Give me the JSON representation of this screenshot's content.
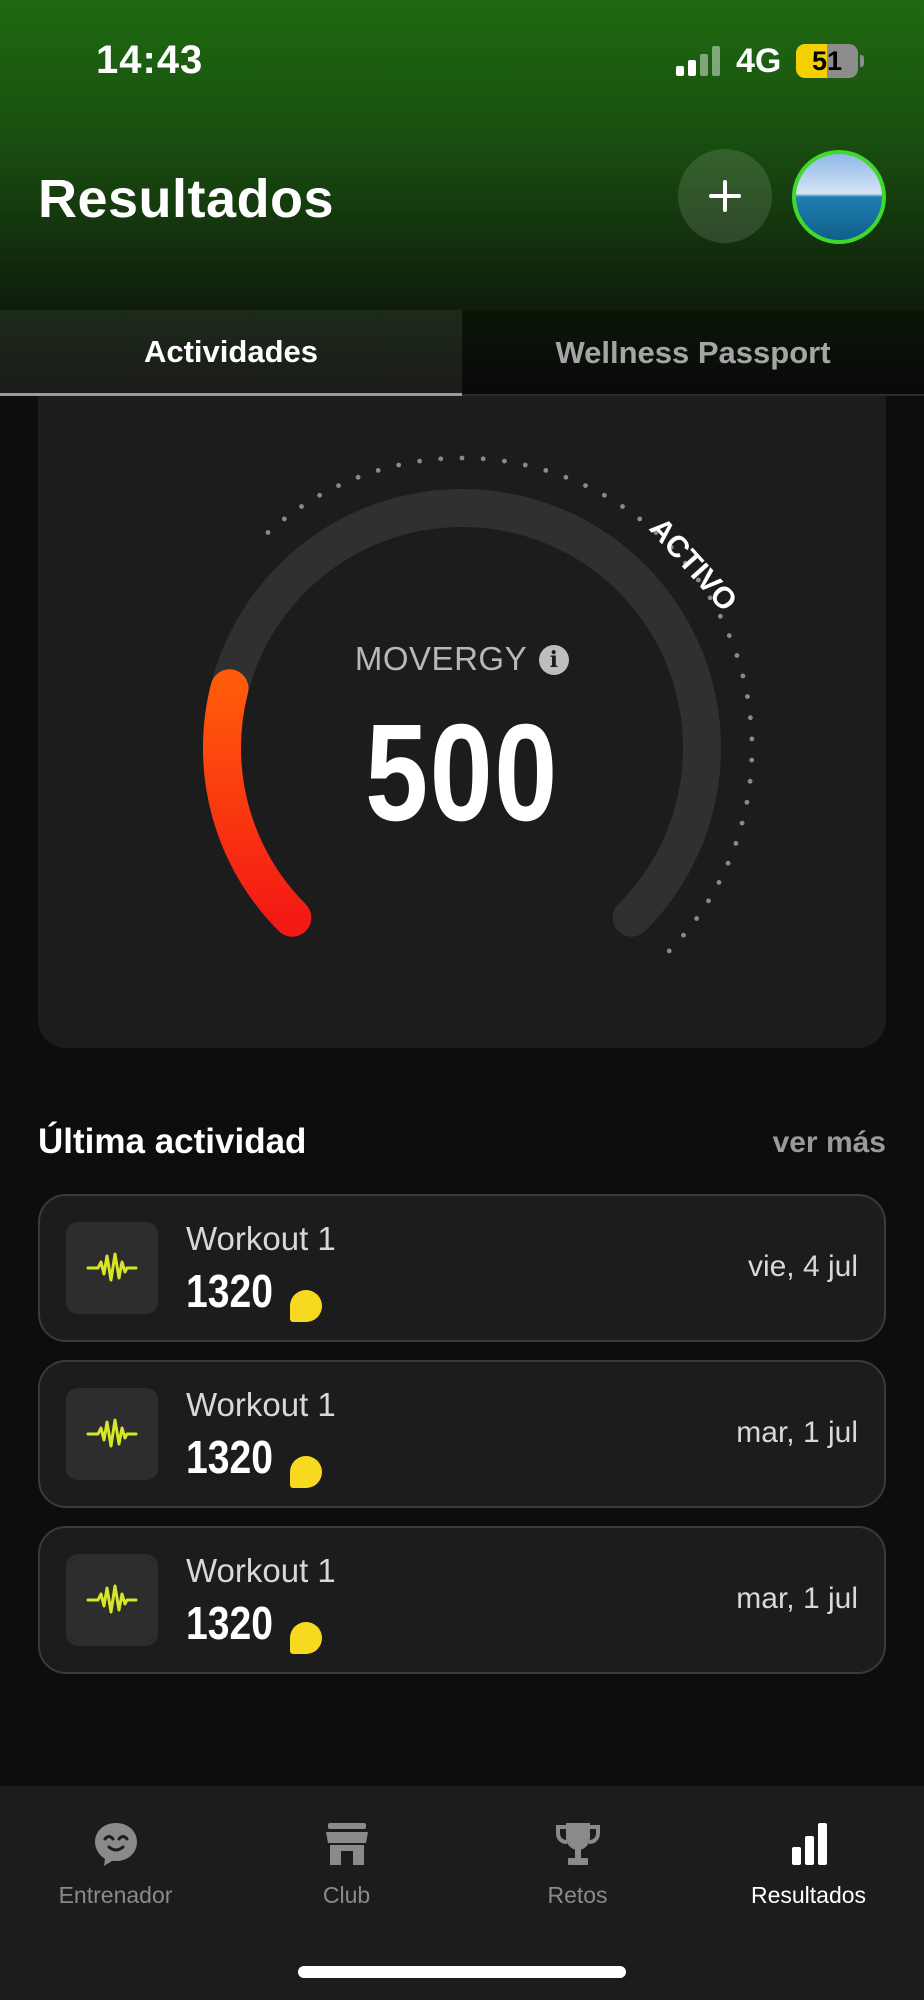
{
  "status_bar": {
    "time": "14:43",
    "network": "4G",
    "battery": "51"
  },
  "header": {
    "title": "Resultados",
    "add_icon": "plus-icon",
    "avatar_icon": "profile-photo-icon"
  },
  "tabs": [
    {
      "label": "Actividades",
      "active": true
    },
    {
      "label": "Wellness Passport",
      "active": false
    }
  ],
  "gauge": {
    "label": "MOVERGY",
    "value": "500",
    "zone_label": "ACTIVO",
    "level": 0.22,
    "colors": {
      "start": "#f41a14",
      "end": "#ff5a0a",
      "track": "#303030"
    }
  },
  "last_activity": {
    "title": "Última actividad",
    "see_more": "ver más",
    "items": [
      {
        "name": "Workout 1",
        "value": "1320",
        "date": "vie, 4 jul",
        "icon": "heartbeat-wave-icon"
      },
      {
        "name": "Workout 1",
        "value": "1320",
        "date": "mar, 1 jul",
        "icon": "heartbeat-wave-icon"
      },
      {
        "name": "Workout 1",
        "value": "1320",
        "date": "mar, 1 jul",
        "icon": "heartbeat-wave-icon"
      }
    ]
  },
  "bottom_nav": [
    {
      "label": "Entrenador",
      "icon": "coach-chat-icon",
      "active": false
    },
    {
      "label": "Club",
      "icon": "storefront-icon",
      "active": false
    },
    {
      "label": "Retos",
      "icon": "trophy-icon",
      "active": false
    },
    {
      "label": "Resultados",
      "icon": "bar-chart-icon",
      "active": true
    }
  ],
  "colors": {
    "accent_green": "#41d82e",
    "coin_yellow": "#f7da1f",
    "activity_icon": "#d7e629"
  }
}
